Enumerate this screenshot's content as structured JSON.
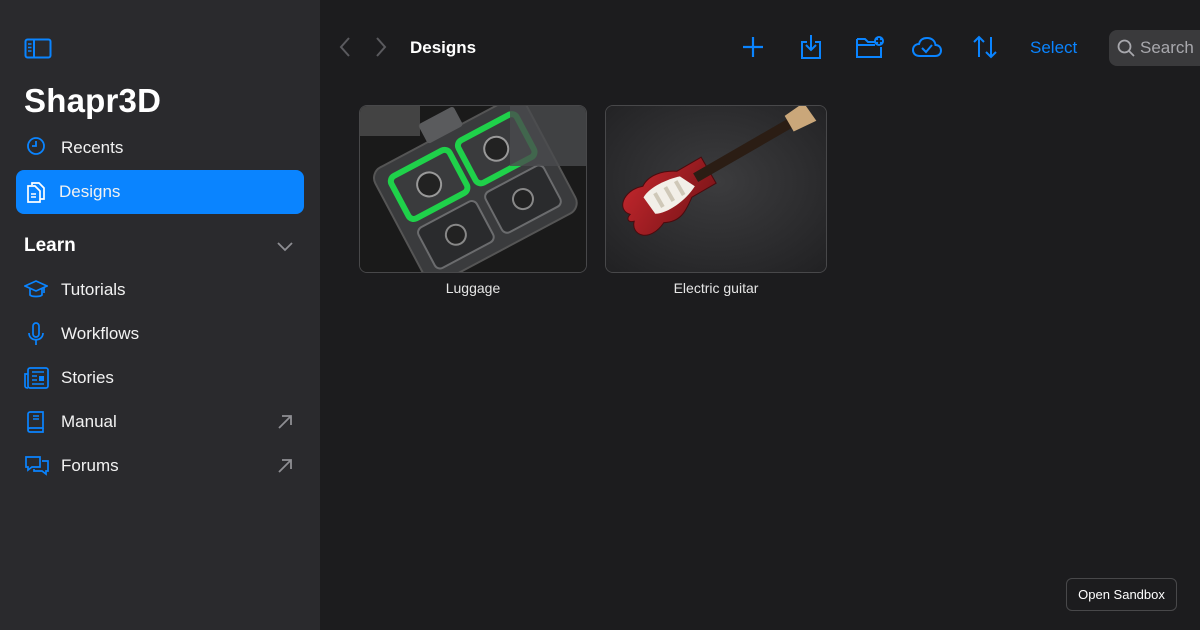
{
  "sidebar": {
    "brand": "Shapr3D",
    "items": [
      {
        "label": "Recents",
        "icon": "clock-icon",
        "active": false
      },
      {
        "label": "Designs",
        "icon": "documents-icon",
        "active": true
      }
    ],
    "learn": {
      "title": "Learn",
      "items": [
        {
          "label": "Tutorials",
          "icon": "graduation-cap-icon",
          "external": false
        },
        {
          "label": "Workflows",
          "icon": "microphone-icon",
          "external": false
        },
        {
          "label": "Stories",
          "icon": "newspaper-icon",
          "external": false
        },
        {
          "label": "Manual",
          "icon": "book-icon",
          "external": true
        },
        {
          "label": "Forums",
          "icon": "chat-bubbles-icon",
          "external": true
        }
      ]
    }
  },
  "toolbar": {
    "title": "Designs",
    "select_label": "Select",
    "search_placeholder": "Search",
    "icons": [
      "back-chevron-icon",
      "forward-chevron-icon",
      "plus-icon",
      "import-icon",
      "new-folder-icon",
      "cloud-check-icon",
      "sort-icon",
      "search-icon"
    ]
  },
  "designs": [
    {
      "name": "Luggage"
    },
    {
      "name": "Electric guitar"
    }
  ],
  "sandbox_label": "Open Sandbox",
  "colors": {
    "accent": "#0a84ff",
    "sidebar_bg": "#2a2a2d",
    "main_bg": "#1c1c1e"
  }
}
